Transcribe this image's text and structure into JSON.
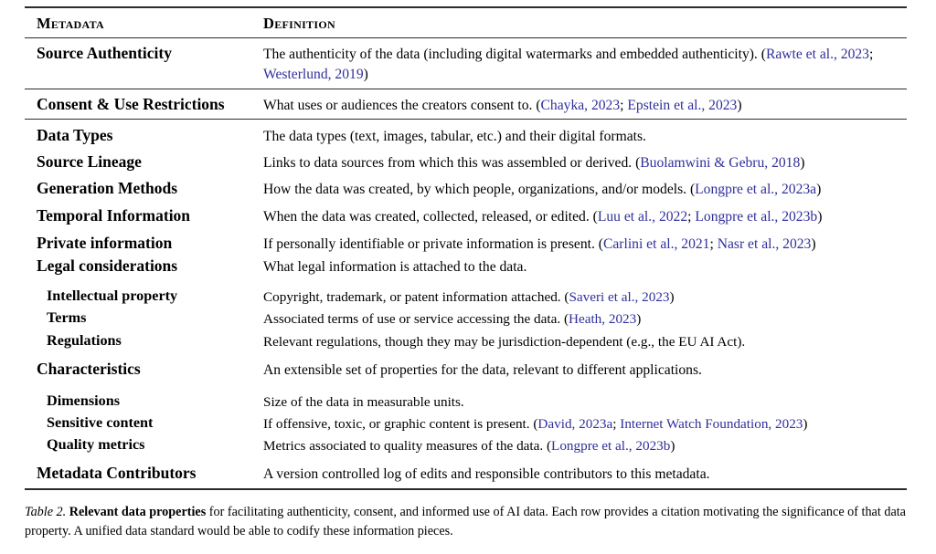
{
  "table": {
    "headers": {
      "metadata": "Metadata",
      "definition": "Definition"
    },
    "citation_color": "#2f2f9c",
    "rows": [
      {
        "label": "Source Authenticity",
        "level": "main",
        "definition_parts": [
          {
            "text": "The authenticity of the data (including digital watermarks and embedded authenticity). (",
            "type": "plain"
          },
          {
            "text": "Rawte et al., 2023",
            "type": "cite"
          },
          {
            "text": "; ",
            "type": "plain"
          },
          {
            "text": "Westerlund, 2019",
            "type": "cite"
          },
          {
            "text": ")",
            "type": "plain"
          }
        ]
      },
      {
        "label": "Consent & Use Restrictions",
        "level": "main",
        "definition_parts": [
          {
            "text": "What uses or audiences the creators consent to. (",
            "type": "plain"
          },
          {
            "text": "Chayka, 2023",
            "type": "cite"
          },
          {
            "text": "; ",
            "type": "plain"
          },
          {
            "text": "Epstein et al., 2023",
            "type": "cite"
          },
          {
            "text": ")",
            "type": "plain"
          }
        ]
      },
      {
        "label": "Data Types",
        "level": "main",
        "definition_parts": [
          {
            "text": "The data types (text, images, tabular, etc.) and their digital formats.",
            "type": "plain"
          }
        ]
      },
      {
        "label": "Source Lineage",
        "level": "main",
        "definition_parts": [
          {
            "text": "Links to data sources from which this was assembled or derived. (",
            "type": "plain"
          },
          {
            "text": "Buolamwini & Gebru, 2018",
            "type": "cite"
          },
          {
            "text": ")",
            "type": "plain"
          }
        ]
      },
      {
        "label": "Generation Methods",
        "level": "main",
        "definition_parts": [
          {
            "text": "How the data was created, by which people, organizations, and/or models. (",
            "type": "plain"
          },
          {
            "text": "Longpre et al., 2023a",
            "type": "cite"
          },
          {
            "text": ")",
            "type": "plain"
          }
        ]
      },
      {
        "label": "Temporal Information",
        "level": "main",
        "definition_parts": [
          {
            "text": "When the data was created, collected, released, or edited. (",
            "type": "plain"
          },
          {
            "text": "Luu et al., 2022",
            "type": "cite"
          },
          {
            "text": "; ",
            "type": "plain"
          },
          {
            "text": "Longpre et al., 2023b",
            "type": "cite"
          },
          {
            "text": ")",
            "type": "plain"
          }
        ]
      },
      {
        "label": "Private information",
        "level": "main",
        "definition_parts": [
          {
            "text": "If personally identifiable or private information is present. (",
            "type": "plain"
          },
          {
            "text": "Carlini et al., 2021",
            "type": "cite"
          },
          {
            "text": "; ",
            "type": "plain"
          },
          {
            "text": "Nasr et al., 2023",
            "type": "cite"
          },
          {
            "text": ")",
            "type": "plain"
          }
        ]
      },
      {
        "label": "Legal considerations",
        "level": "main",
        "definition_parts": [
          {
            "text": "What legal information is attached to the data.",
            "type": "plain"
          }
        ]
      },
      {
        "label": "Intellectual property",
        "level": "sub",
        "definition_parts": [
          {
            "text": "Copyright, trademark, or patent information attached. (",
            "type": "plain"
          },
          {
            "text": "Saveri et al., 2023",
            "type": "cite"
          },
          {
            "text": ")",
            "type": "plain"
          }
        ]
      },
      {
        "label": "Terms",
        "level": "sub",
        "definition_parts": [
          {
            "text": "Associated terms of use or service accessing the data. (",
            "type": "plain"
          },
          {
            "text": "Heath, 2023",
            "type": "cite"
          },
          {
            "text": ")",
            "type": "plain"
          }
        ]
      },
      {
        "label": "Regulations",
        "level": "sub",
        "definition_parts": [
          {
            "text": "Relevant regulations, though they may be jurisdiction-dependent (e.g., the EU AI Act).",
            "type": "plain"
          }
        ]
      },
      {
        "label": "Characteristics",
        "level": "main",
        "definition_parts": [
          {
            "text": "An extensible set of properties for the data, relevant to different applications.",
            "type": "plain"
          }
        ]
      },
      {
        "label": "Dimensions",
        "level": "sub",
        "definition_parts": [
          {
            "text": "Size of the data in measurable units.",
            "type": "plain"
          }
        ]
      },
      {
        "label": "Sensitive content",
        "level": "sub",
        "definition_parts": [
          {
            "text": "If offensive, toxic, or graphic content is present. (",
            "type": "plain"
          },
          {
            "text": "David, 2023a",
            "type": "cite"
          },
          {
            "text": "; ",
            "type": "plain"
          },
          {
            "text": "Internet Watch Foundation, 2023",
            "type": "cite"
          },
          {
            "text": ")",
            "type": "plain"
          }
        ]
      },
      {
        "label": "Quality metrics",
        "level": "sub",
        "definition_parts": [
          {
            "text": "Metrics associated to quality measures of the data. (",
            "type": "plain"
          },
          {
            "text": "Longpre et al., 2023b",
            "type": "cite"
          },
          {
            "text": ")",
            "type": "plain"
          }
        ]
      },
      {
        "label": "Metadata Contributors",
        "level": "main",
        "definition_parts": [
          {
            "text": "A version controlled log of edits and responsible contributors to this metadata.",
            "type": "plain"
          }
        ]
      }
    ]
  },
  "caption": {
    "number": "Table 2.",
    "lead": "Relevant data properties",
    "rest": " for facilitating authenticity, consent, and informed use of AI data. Each row provides a citation motivating the significance of that data property. A unified data standard would be able to codify these information pieces."
  }
}
